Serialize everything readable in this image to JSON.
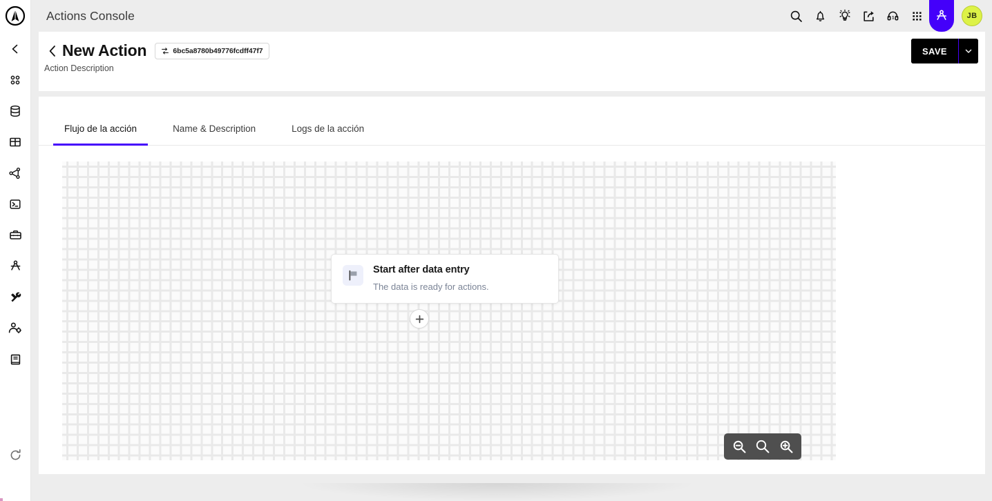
{
  "app": {
    "logo_icon": "circle-a-logo-icon",
    "top_bar_title": "Actions Console"
  },
  "top_bar": {
    "actions": [
      {
        "name": "search-icon",
        "label": "Search"
      },
      {
        "name": "notifications-bell-icon",
        "label": "Notifications"
      },
      {
        "name": "ideas-lightbulb-icon",
        "label": "Ideas"
      },
      {
        "name": "share-export-icon",
        "label": "Share"
      },
      {
        "name": "support-headset-icon",
        "label": "Support"
      },
      {
        "name": "apps-grid-icon",
        "label": "Apps"
      },
      {
        "name": "compass-divider-icon",
        "label": "Actions",
        "active": true
      }
    ],
    "avatar_initials": "JB",
    "avatar_color": "#ddf247"
  },
  "sidebar": {
    "items": [
      {
        "name": "collapse-chevron-icon",
        "label": "Collapse"
      },
      {
        "name": "dots-grid-icon",
        "label": "Dashboard"
      },
      {
        "name": "database-icon",
        "label": "Data"
      },
      {
        "name": "table-icon",
        "label": "Tables"
      },
      {
        "name": "graph-nodes-icon",
        "label": "Flows"
      },
      {
        "name": "terminal-icon",
        "label": "Console"
      },
      {
        "name": "toolbox-icon",
        "label": "Toolbox"
      },
      {
        "name": "compass-divider-icon",
        "label": "Actions"
      },
      {
        "name": "tools-wrench-screwdriver-icon",
        "label": "Settings"
      },
      {
        "name": "user-settings-icon",
        "label": "Users"
      },
      {
        "name": "book-icon",
        "label": "Docs"
      },
      {
        "name": "refresh-icon",
        "label": "Refresh"
      }
    ]
  },
  "header": {
    "back_label": "Back",
    "title": "New Action",
    "id_badge": {
      "icon": "transfer-copy-icon",
      "value": "6bc5a8780b49776fcdff47f7"
    },
    "description": "Action Description",
    "save_label": "SAVE",
    "save_caret_icon": "chevron-down-icon",
    "accent_color": "#4400fa"
  },
  "tabs": [
    {
      "label": "Flujo de la acción",
      "active": true
    },
    {
      "label": "Name & Description",
      "active": false
    },
    {
      "label": "Logs de la acción",
      "active": false
    }
  ],
  "canvas": {
    "start_node": {
      "icon": "flag-icon",
      "title": "Start after data entry",
      "subtitle": "The data is ready for actions."
    },
    "add_step_icon": "plus-icon",
    "zoom_controls": [
      {
        "name": "zoom-out-icon",
        "label": "Zoom out"
      },
      {
        "name": "zoom-reset-icon",
        "label": "Reset zoom"
      },
      {
        "name": "zoom-in-icon",
        "label": "Zoom in"
      }
    ]
  }
}
